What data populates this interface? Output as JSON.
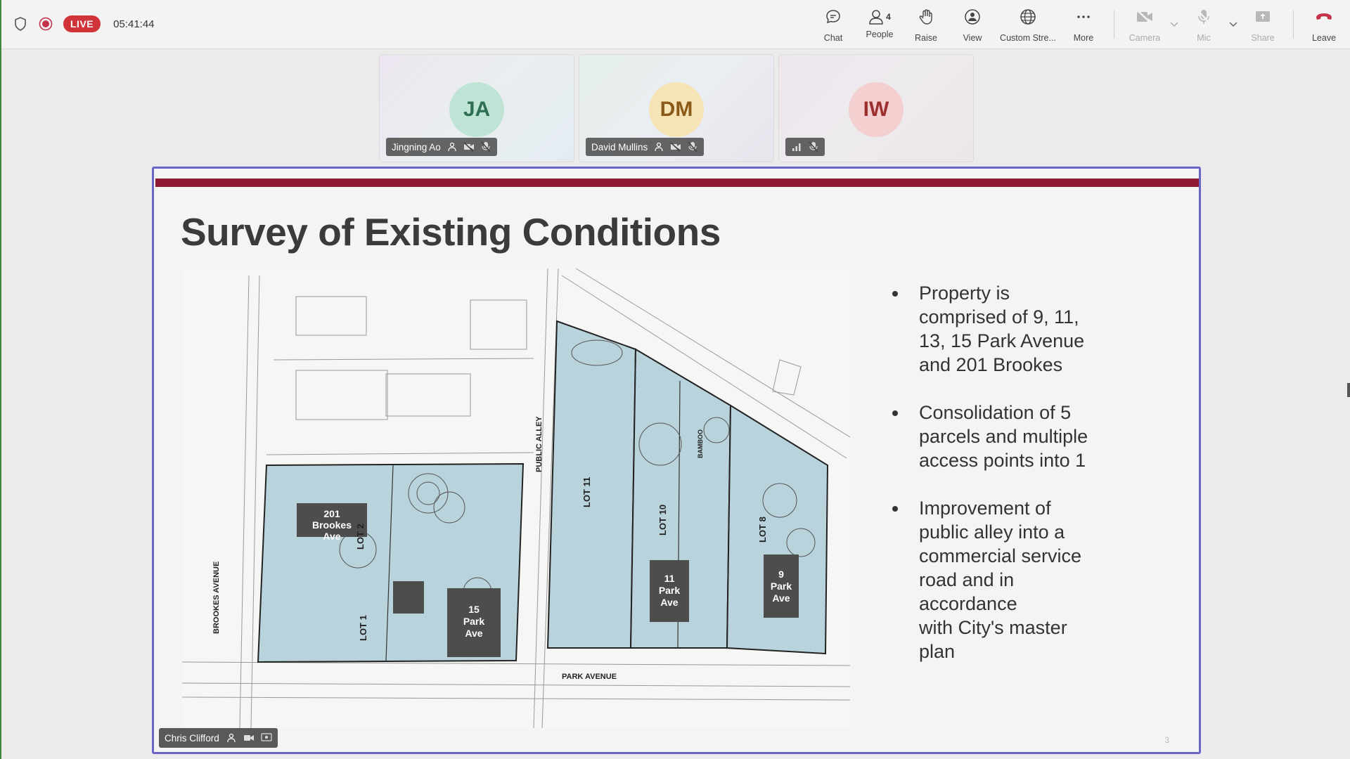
{
  "status": {
    "live_label": "LIVE",
    "timer": "05:41:44"
  },
  "toolbar": {
    "chat": "Chat",
    "people": "People",
    "people_count": "4",
    "raise": "Raise",
    "view": "View",
    "custom_streaming": "Custom Stre...",
    "more": "More",
    "camera": "Camera",
    "mic": "Mic",
    "share": "Share",
    "leave": "Leave"
  },
  "participants": [
    {
      "initials": "JA",
      "name": "Jingning Ao"
    },
    {
      "initials": "DM",
      "name": "David Mullins"
    },
    {
      "initials": "IW",
      "name": ""
    }
  ],
  "presenter": {
    "name": "Chris Clifford"
  },
  "slide": {
    "title": "Survey of Existing Conditions",
    "page_number": "3",
    "bullets": [
      "Property is\ncomprised of 9, 11,\n13, 15 Park Avenue\nand 201 Brookes",
      "Consolidation of 5\nparcels and multiple\naccess points into 1",
      "Improvement of\npublic alley into a\ncommercial service\nroad and in\naccordance\nwith City's master\nplan"
    ],
    "plan_labels": {
      "bldg_201": "201\nBrookes\nAve",
      "bldg_15": "15\nPark\nAve",
      "bldg_11": "11\nPark\nAve",
      "bldg_9": "9\nPark\nAve",
      "lot1": "LOT 1",
      "lot2": "LOT 2",
      "lot11": "LOT 11",
      "lot10": "LOT 10",
      "lot8": "LOT 8",
      "public_alley": "PUBLIC ALLEY",
      "park_avenue": "PARK AVENUE",
      "brookes_avenue": "BROOKES AVENUE",
      "bamboo": "BAMBOO"
    }
  },
  "colors": {
    "live": "#d13438",
    "slide_bar": "#8e1b33",
    "share_border": "#6b64c9",
    "parcel_fill": "#b9d3dc",
    "leave": "#c4314b"
  }
}
